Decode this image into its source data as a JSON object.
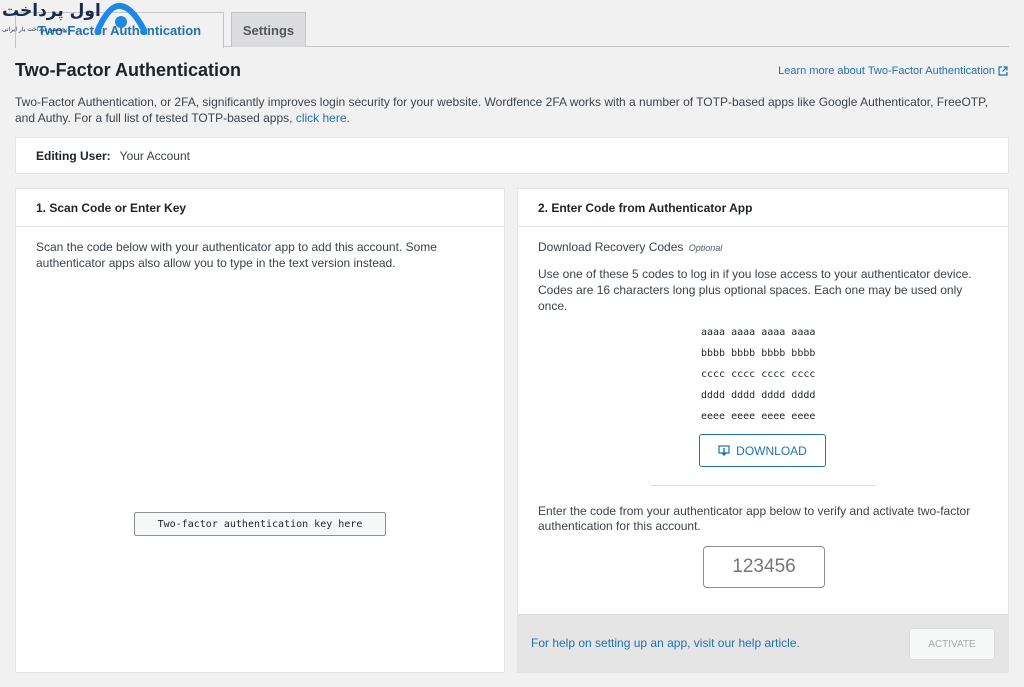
{
  "logo": {
    "text": "اول پرداخت",
    "subtext": "نخستین پرداخت یار ایرانی"
  },
  "tabs": [
    {
      "label": "Two-Factor Authentication",
      "active": true
    },
    {
      "label": "Settings",
      "active": false
    }
  ],
  "header": {
    "title": "Two-Factor Authentication",
    "learn_more": "Learn more about Two-Factor Authentication",
    "learn_more_icon": "external-link-icon"
  },
  "intro": {
    "text": "Two-Factor Authentication, or 2FA, significantly improves login security for your website. Wordfence 2FA works with a number of TOTP-based apps like Google Authenticator, FreeOTP, and Authy. For a full list of tested TOTP-based apps, ",
    "link": "click here."
  },
  "editing_user": {
    "label": "Editing User:",
    "value": "Your Account"
  },
  "scan_panel": {
    "title": "1. Scan Code or Enter Key",
    "description": "Scan the code below with your authenticator app to add this account. Some authenticator apps also allow you to type in the text version instead.",
    "key_placeholder": "Two-factor authentication key here"
  },
  "code_panel": {
    "title": "2. Enter Code from Authenticator App",
    "recovery_title": "Download Recovery Codes",
    "recovery_optional": "Optional",
    "recovery_desc": "Use one of these 5 codes to log in if you lose access to your authenticator device. Codes are 16 characters long plus optional spaces. Each one may be used only once.",
    "codes": [
      "aaaa aaaa aaaa aaaa",
      "bbbb bbbb bbbb bbbb",
      "cccc cccc cccc cccc",
      "dddd dddd dddd dddd",
      "eeee eeee eeee eeee"
    ],
    "download_label": "DOWNLOAD",
    "download_icon": "download-icon",
    "verify_desc": "Enter the code from your authenticator app below to verify and activate two-factor authentication for this account.",
    "code_placeholder": "123456",
    "help_text": "For help on setting up an app, visit our help article.",
    "activate_label": "ACTIVATE"
  },
  "colors": {
    "accent": "#2271b1",
    "background": "#f1f1f1"
  }
}
